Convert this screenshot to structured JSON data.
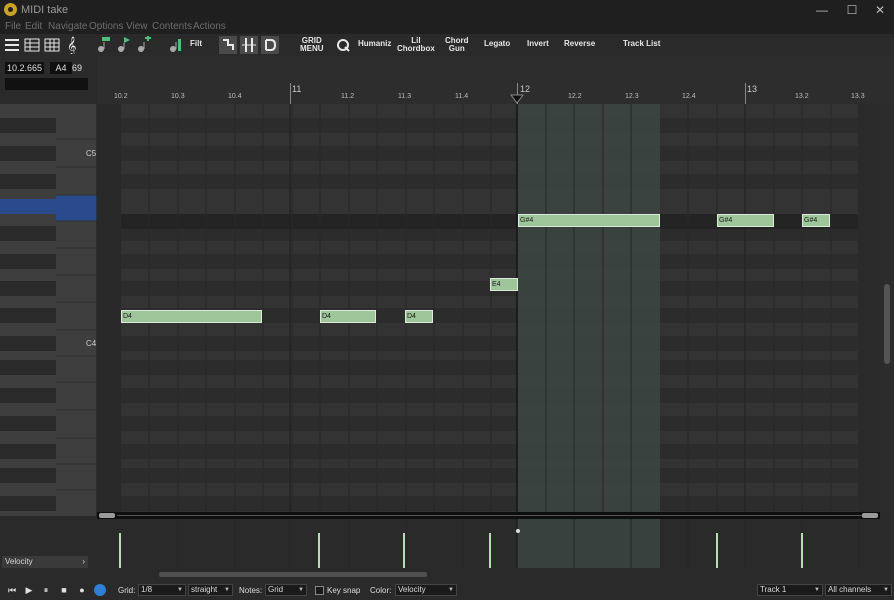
{
  "window": {
    "title": "MIDI take",
    "minimize": "—",
    "maximize": "☐",
    "close": "✕"
  },
  "menu": [
    "File",
    "Edit",
    "Navigate",
    "Options",
    "View",
    "Contents",
    "Actions"
  ],
  "toolbar": {
    "filter": "Filt",
    "grid_menu": [
      "GRID",
      "MENU"
    ],
    "humanize": "Humaniz",
    "lil_chordbox": [
      "Lil",
      "Chordbox"
    ],
    "chord_gun": [
      "Chord",
      "Gun"
    ],
    "legato": "Legato",
    "invert": "Invert",
    "reverse": "Reverse",
    "track_list": "Track List"
  },
  "position": {
    "time": "10.2.665",
    "note": "A4",
    "value": "69"
  },
  "ruler": {
    "major": [
      "11",
      "12",
      "13"
    ],
    "minor": [
      "10.2",
      "10.3",
      "10.4",
      "11.2",
      "11.3",
      "11.4",
      "12.2",
      "12.3",
      "12.4",
      "13.2",
      "13.3"
    ]
  },
  "keyboard": {
    "labels": [
      "C5",
      "C4"
    ]
  },
  "notes": [
    {
      "label": "D4",
      "pitch": "D4",
      "start": "10.2",
      "length_beats": 2.5
    },
    {
      "label": "D4",
      "pitch": "D4",
      "start": "11.1.5",
      "length_beats": 1
    },
    {
      "label": "D4",
      "pitch": "D4",
      "start": "11.3",
      "length_beats": 0.5
    },
    {
      "label": "E4",
      "pitch": "E4",
      "start": "11.4.5",
      "length_beats": 0.5
    },
    {
      "label": "G#4",
      "pitch": "G#4",
      "start": "12.1",
      "length_beats": 2.5
    },
    {
      "label": "G#4",
      "pitch": "G#4",
      "start": "12.4.5",
      "length_beats": 1
    },
    {
      "label": "G#4",
      "pitch": "G#4",
      "start": "13.2",
      "length_beats": 0.5
    }
  ],
  "lane": {
    "label": "Velocity",
    "arrow": "›"
  },
  "bottom": {
    "grid_label": "Grid:",
    "grid_value": "1/8",
    "swing_value": "straight",
    "notes_label": "Notes:",
    "notes_value": "Grid",
    "key_snap": "Key snap",
    "color_label": "Color:",
    "color_value": "Velocity",
    "track_value": "Track 1",
    "channel_value": "All channels"
  },
  "colors": {
    "note": "#9ec69a",
    "playhead": "#1e1e1e",
    "selection": "#3d4a46",
    "keyboard_highlight": "#2b4a8e",
    "accent_icon": "#4fc07c"
  }
}
